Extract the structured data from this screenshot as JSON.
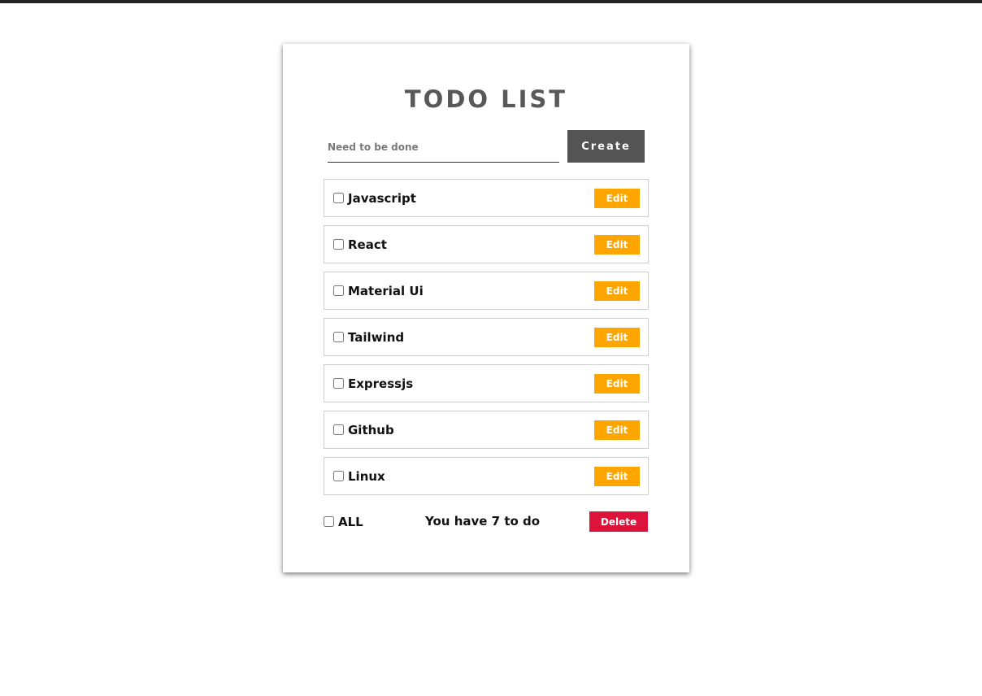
{
  "title": "TODO LIST",
  "input": {
    "placeholder": "Need to be done",
    "value": ""
  },
  "create_label": "Create",
  "items": [
    {
      "label": "Javascript",
      "edit_label": "Edit",
      "checked": false
    },
    {
      "label": "React",
      "edit_label": "Edit",
      "checked": false
    },
    {
      "label": "Material Ui",
      "edit_label": "Edit",
      "checked": false
    },
    {
      "label": "Tailwind",
      "edit_label": "Edit",
      "checked": false
    },
    {
      "label": "Expressjs",
      "edit_label": "Edit",
      "checked": false
    },
    {
      "label": "Github",
      "edit_label": "Edit",
      "checked": false
    },
    {
      "label": "Linux",
      "edit_label": "Edit",
      "checked": false
    }
  ],
  "footer": {
    "all_label": "ALL",
    "all_checked": false,
    "count_text": "You have 7 to do",
    "delete_label": "Delete"
  },
  "colors": {
    "title": "#585858",
    "create_button": "#545454",
    "edit_button": "#ffa500",
    "delete_button": "#dc143c"
  }
}
